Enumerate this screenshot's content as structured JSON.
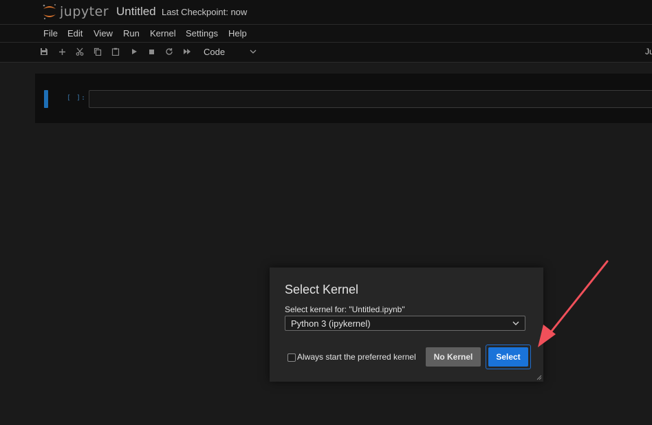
{
  "header": {
    "logo_text": "jupyter",
    "notebook_title": "Untitled",
    "checkpoint": "Last Checkpoint: now"
  },
  "menu": {
    "items": [
      "File",
      "Edit",
      "View",
      "Run",
      "Kernel",
      "Settings",
      "Help"
    ]
  },
  "toolbar": {
    "icons": [
      "save-icon",
      "add-cell-icon",
      "cut-icon",
      "copy-icon",
      "paste-icon",
      "run-icon",
      "stop-icon",
      "restart-icon",
      "fast-forward-icon"
    ],
    "cell_type": "Code",
    "kernel_indicator": "Ju"
  },
  "cell": {
    "prompt": "[ ]:"
  },
  "dialog": {
    "title": "Select Kernel",
    "label": "Select kernel for: \"Untitled.ipynb\"",
    "selected_kernel": "Python 3 (ipykernel)",
    "checkbox_label": "Always start the preferred kernel",
    "checkbox_checked": false,
    "no_kernel_label": "No Kernel",
    "select_label": "Select"
  },
  "colors": {
    "accent": "#1a73d9",
    "annotation_arrow": "#f0505a",
    "background": "#1a1a1a"
  }
}
